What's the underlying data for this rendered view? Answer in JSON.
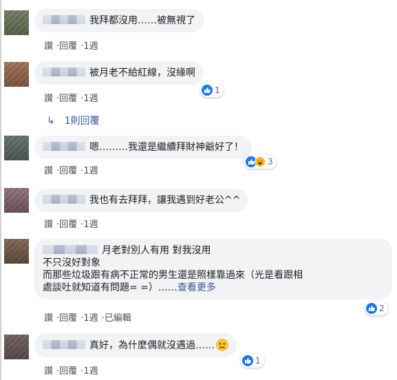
{
  "actions": {
    "like": "讚",
    "reply": "回覆",
    "edited": "已編輯",
    "sep": "·"
  },
  "comments": [
    {
      "text": "我拜都沒用……被無視了",
      "time": "1週"
    },
    {
      "text": "被月老不給紅線，沒緣啊",
      "time": "1週",
      "reactions": {
        "count": "1",
        "types": [
          "like-icon"
        ]
      }
    },
    {
      "text": "嗯………我還是繼續拜財神爺好了！",
      "time": "1週",
      "reactions": {
        "count": "3",
        "types": [
          "like-icon",
          "haha-icon"
        ]
      }
    },
    {
      "text": "我也有去拜拜，讓我遇到好老公^^",
      "time": "1週"
    },
    {
      "line1": "月老對別人有用 對我沒用",
      "line2": "不只沒好對象",
      "line3": "而那些垃圾跟有病不正常的男生還是照樣靠過來（光是看跟相",
      "line4": "處談吐就知道有問題= =）……",
      "see_more": "查看更多",
      "time": "1週",
      "reactions": {
        "count": "2",
        "types": [
          "like-icon"
        ]
      }
    },
    {
      "text": "真好，為什麼偶就沒遇過……",
      "emoji": "sad-emoji",
      "time": "1週",
      "reactions": {
        "count": "1",
        "types": [
          "like-icon"
        ]
      }
    }
  ],
  "replies_link": {
    "arrow": "↳",
    "label": "1則回覆"
  },
  "colors": {
    "link": "#385898",
    "bubble": "#f2f3f5",
    "like": "#1877f2",
    "haha": "#f7b928"
  }
}
